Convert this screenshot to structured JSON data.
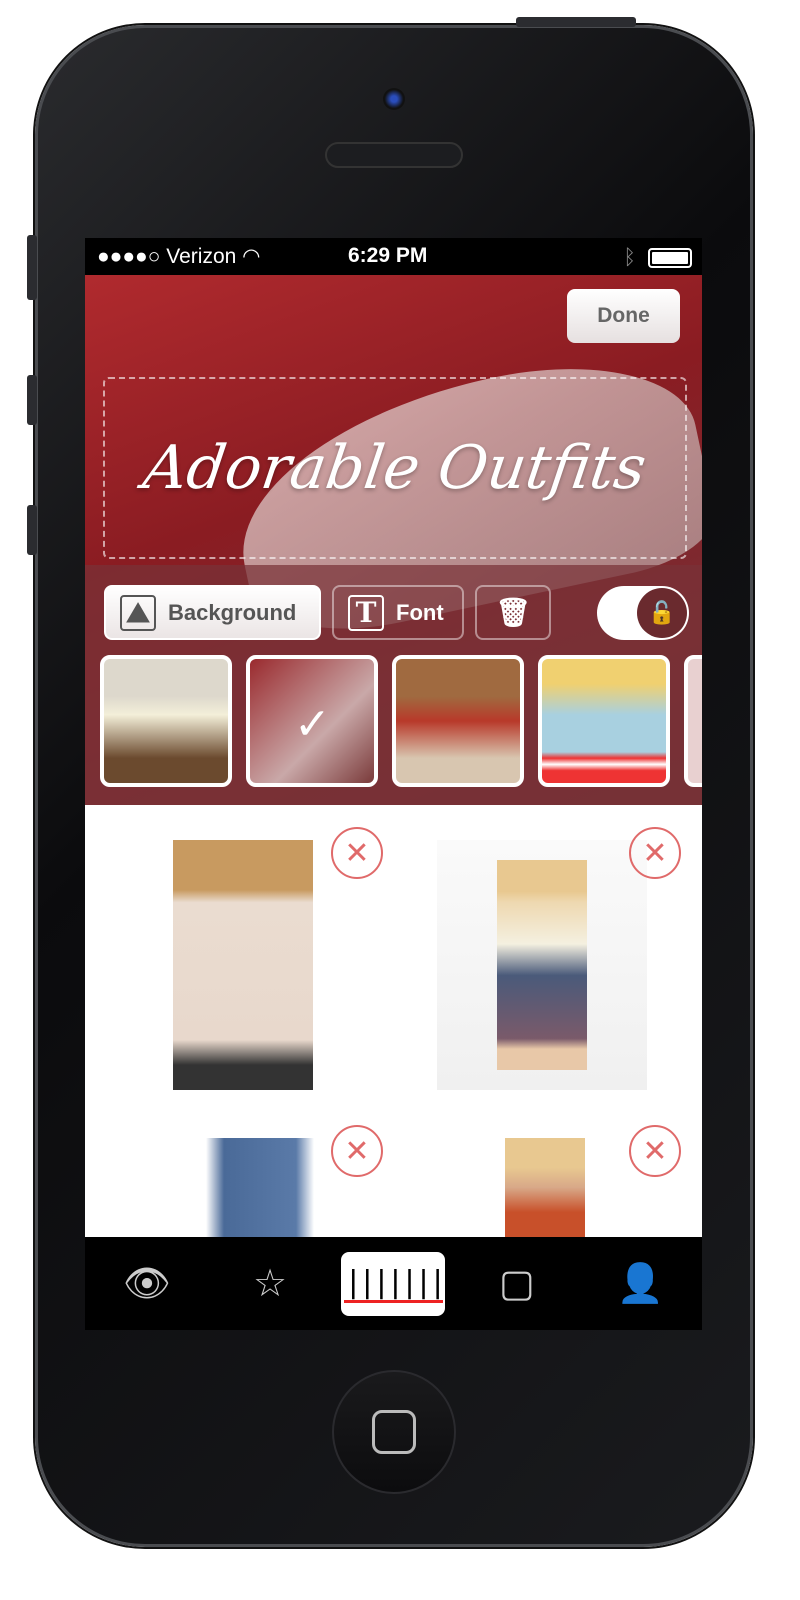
{
  "status": {
    "signal": "●●●●○",
    "carrier": "Verizon",
    "time": "6:29 PM"
  },
  "header": {
    "done_label": "Done",
    "title": "Adorable Outfits"
  },
  "toolbar": {
    "background_label": "Background",
    "font_label": "Font",
    "font_icon_glyph": "T",
    "lock_state": "unlocked"
  },
  "backgrounds": [
    {
      "name": "book"
    },
    {
      "name": "red-shoe",
      "selected": true
    },
    {
      "name": "mug"
    },
    {
      "name": "popcorn-tickets"
    },
    {
      "name": "partial"
    }
  ],
  "items": [
    {
      "name": "striped-sweater"
    },
    {
      "name": "strapless-dress"
    },
    {
      "name": "blue-jeans"
    },
    {
      "name": "patterned-top"
    }
  ],
  "tabs": [
    {
      "name": "watch",
      "icon": "eye-icon"
    },
    {
      "name": "favorites",
      "icon": "star-icon"
    },
    {
      "name": "scan",
      "icon": "barcode-icon",
      "active": true
    },
    {
      "name": "notifications",
      "icon": "notification-icon"
    },
    {
      "name": "profile",
      "icon": "profile-card-icon"
    }
  ],
  "colors": {
    "accent": "#e06a6a",
    "header": "#8a1c22"
  }
}
